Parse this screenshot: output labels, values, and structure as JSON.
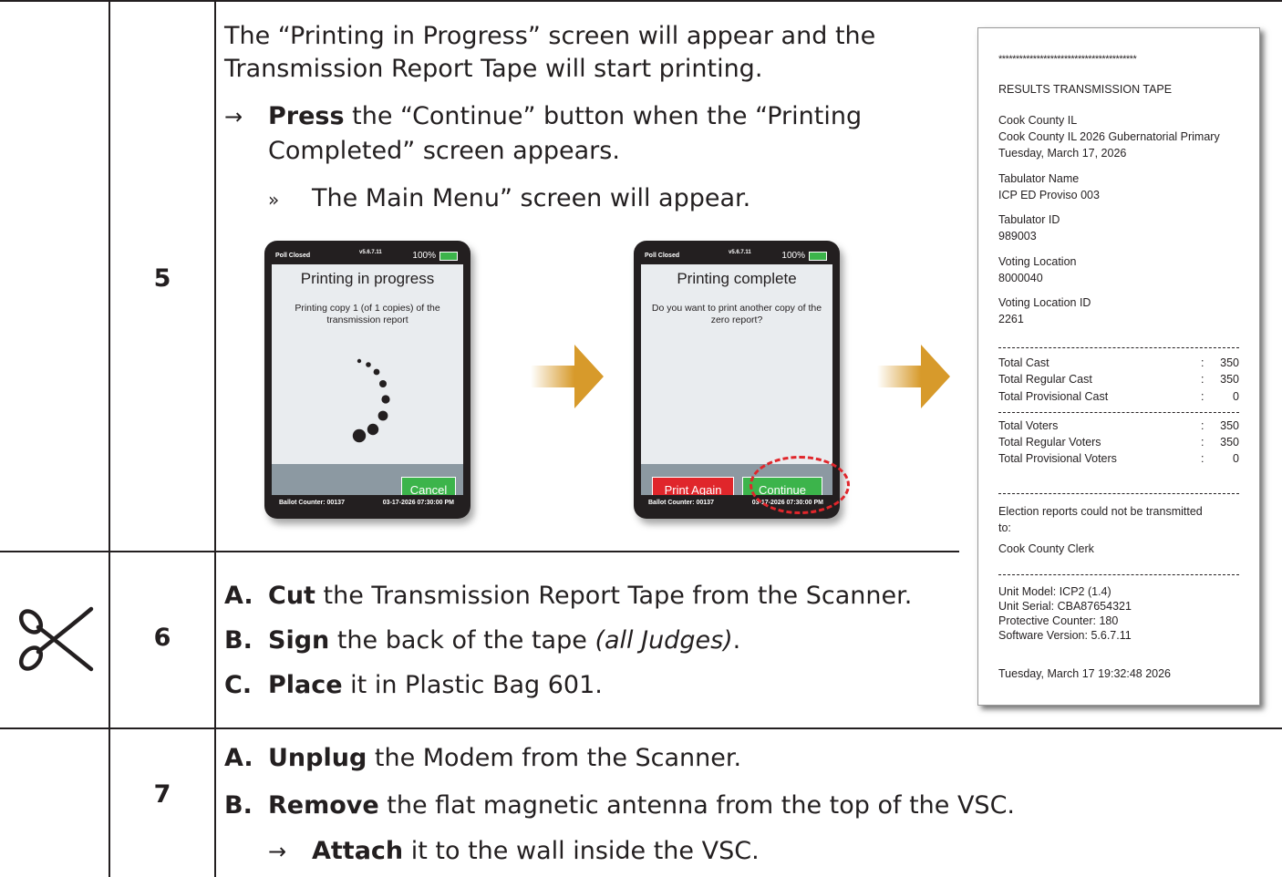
{
  "step5": {
    "number": "5",
    "line1": "The “Printing in Progress” screen will appear and the",
    "line2": "Transmission Report Tape will start printing.",
    "press_bold": "Press",
    "press_rest1": " the “Continue” button when the “Printing",
    "press_rest2": "Completed” screen appears.",
    "sub_marker": "»",
    "sub_text": "The Main Menu” screen will appear."
  },
  "screen1": {
    "status_left": "Poll Closed",
    "status_center": "v5.6.7.11",
    "status_right": "100%",
    "title": "Printing in progress",
    "body": "Printing copy 1 (of 1 copies) of the transmission report",
    "cancel_label": "Cancel",
    "footer_left": "Ballot Counter: 00137",
    "footer_right": "03-17-2026  07:30:00 PM"
  },
  "screen2": {
    "status_left": "Poll Closed",
    "status_center": "v5.6.7.11",
    "status_right": "100%",
    "title": "Printing complete",
    "body": "Do you want to print another copy of the zero report?",
    "print_again_label": "Print Again",
    "continue_label": "Continue",
    "footer_left": "Ballot Counter: 00137",
    "footer_right": "03-17-2026  07:30:00 PM"
  },
  "step6": {
    "number": "6",
    "a_letter": "A.",
    "a_bold": "Cut",
    "a_rest": " the Transmission Report Tape from the Scanner.",
    "b_letter": "B.",
    "b_bold": "Sign",
    "b_rest": " the back of the tape ",
    "b_italic": "(all Judges)",
    "b_end": ".",
    "c_letter": "C.",
    "c_bold": "Place",
    "c_rest": " it in Plastic Bag 601."
  },
  "step7": {
    "number": "7",
    "a_letter": "A.",
    "a_bold": "Unplug",
    "a_rest": " the Modem from the Scanner.",
    "b_letter": "B.",
    "b_bold": "Remove",
    "b_rest": " the flat magnetic antenna from the top of the VSC.",
    "sub_bold": "Attach",
    "sub_rest": " it to the wall inside the VSC."
  },
  "tape": {
    "stars": "****************************************",
    "title": "RESULTS TRANSMISSION TAPE",
    "county": "Cook County IL",
    "election": "Cook County IL 2026 Gubernatorial Primary",
    "date": "Tuesday, March 17, 2026",
    "tab_name_label": "Tabulator Name",
    "tab_name": "ICP ED Proviso 003",
    "tab_id_label": "Tabulator ID",
    "tab_id": "989003",
    "loc_label": "Voting Location",
    "loc": "8000040",
    "loc_id_label": "Voting Location ID",
    "loc_id": "2261",
    "cast_rows": [
      {
        "k": "Total Cast",
        "v": "350"
      },
      {
        "k": "Total Regular Cast",
        "v": "350"
      },
      {
        "k": "Total Provisional Cast",
        "v": "0"
      }
    ],
    "voter_rows": [
      {
        "k": "Total Voters",
        "v": "350"
      },
      {
        "k": "Total Regular Voters",
        "v": "350"
      },
      {
        "k": "Total Provisional Voters",
        "v": "0"
      }
    ],
    "colon": ":",
    "err1": "Election reports could not be transmitted",
    "err2": "to:",
    "err3": "Cook County Clerk",
    "model": "Unit Model: ICP2 (1.4)",
    "serial": "Unit Serial: CBA87654321",
    "counter": "Protective Counter: 180",
    "software": "Software Version: 5.6.7.11",
    "timestamp": "Tuesday, March 17 19:32:48 2026"
  },
  "icons": {
    "cut": "scissors-icon",
    "arrow": "right-arrow-icon"
  },
  "colors": {
    "arrow": "#d79a2b",
    "green": "#3cb44b",
    "red": "#e0262b",
    "highlight": "#e0262b"
  }
}
